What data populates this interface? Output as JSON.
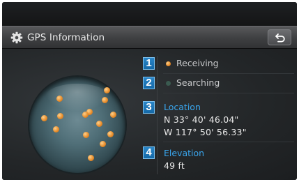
{
  "header": {
    "title": "GPS Information",
    "settings_icon": "gear-icon",
    "back_icon": "back-arrow-icon"
  },
  "legend": [
    {
      "number": "1",
      "label": "Receiving",
      "status": "receiving",
      "color": "#e58a28"
    },
    {
      "number": "2",
      "label": "Searching",
      "status": "searching",
      "color": "#3a5a50"
    }
  ],
  "location": {
    "number": "3",
    "label": "Location",
    "latitude": "N 33° 40' 46.04\"",
    "longitude": "W 117° 50' 56.33\""
  },
  "elevation": {
    "number": "4",
    "label": "Elevation",
    "value": "49 ft"
  },
  "satellites": {
    "receiving_count": 14
  },
  "colors": {
    "accent_label": "#39a6ee",
    "badge": "#1469a8",
    "receiving": "#e58a28"
  }
}
